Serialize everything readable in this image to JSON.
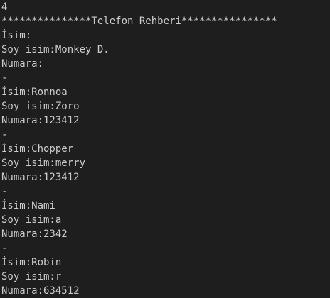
{
  "terminal": {
    "background": "#1e1e1e",
    "foreground": "#cccccc",
    "lines": [
      "4",
      "***************Telefon Rehberi****************",
      "İsim:",
      "Soy isim:Monkey D.",
      "Numara:",
      "-",
      "İsim:Ronnoa",
      "Soy isim:Zoro",
      "Numara:123412",
      "-",
      "İsim:Chopper",
      "Soy isim:merry",
      "Numara:123412",
      "-",
      "İsim:Nami",
      "Soy isim:a",
      "Numara:2342",
      "-",
      "İsim:Robin",
      "Soy isim:r",
      "Numara:634512"
    ]
  }
}
